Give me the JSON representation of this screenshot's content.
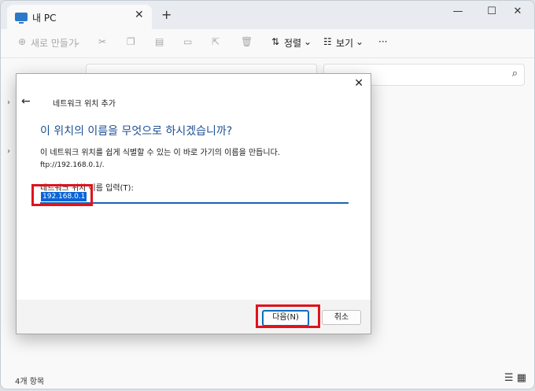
{
  "window": {
    "tab_title": "내 PC",
    "new_tab_symbol": "+",
    "tab_close_symbol": "✕",
    "minimize_symbol": "—",
    "maximize_symbol": "☐",
    "close_symbol": "✕"
  },
  "toolbar": {
    "new_label": "새로 만들기",
    "sort_label": "정렬",
    "view_label": "보기",
    "more_symbol": "···"
  },
  "statusbar": {
    "item_count": "4개 항목"
  },
  "dialog": {
    "title": "네트워크 위치 추가",
    "heading": "이 위치의 이름을 무엇으로 하시겠습니까?",
    "description": "이 네트워크 위치를 쉽게 식별할 수 있는 이 바로 가기의 이름을 만듭니다.",
    "location": "ftp://192.168.0.1/.",
    "input_label": "네트워크 위치 이름 입력(T):",
    "input_value": "192.168.0.1",
    "next_button": "다음(N)",
    "cancel_button": "취소",
    "close_symbol": "✕",
    "back_symbol": "←"
  },
  "colors": {
    "accent": "#0f6cbd",
    "heading": "#1c4f94",
    "highlight": "#e0121c",
    "selection": "#0a64d6"
  }
}
